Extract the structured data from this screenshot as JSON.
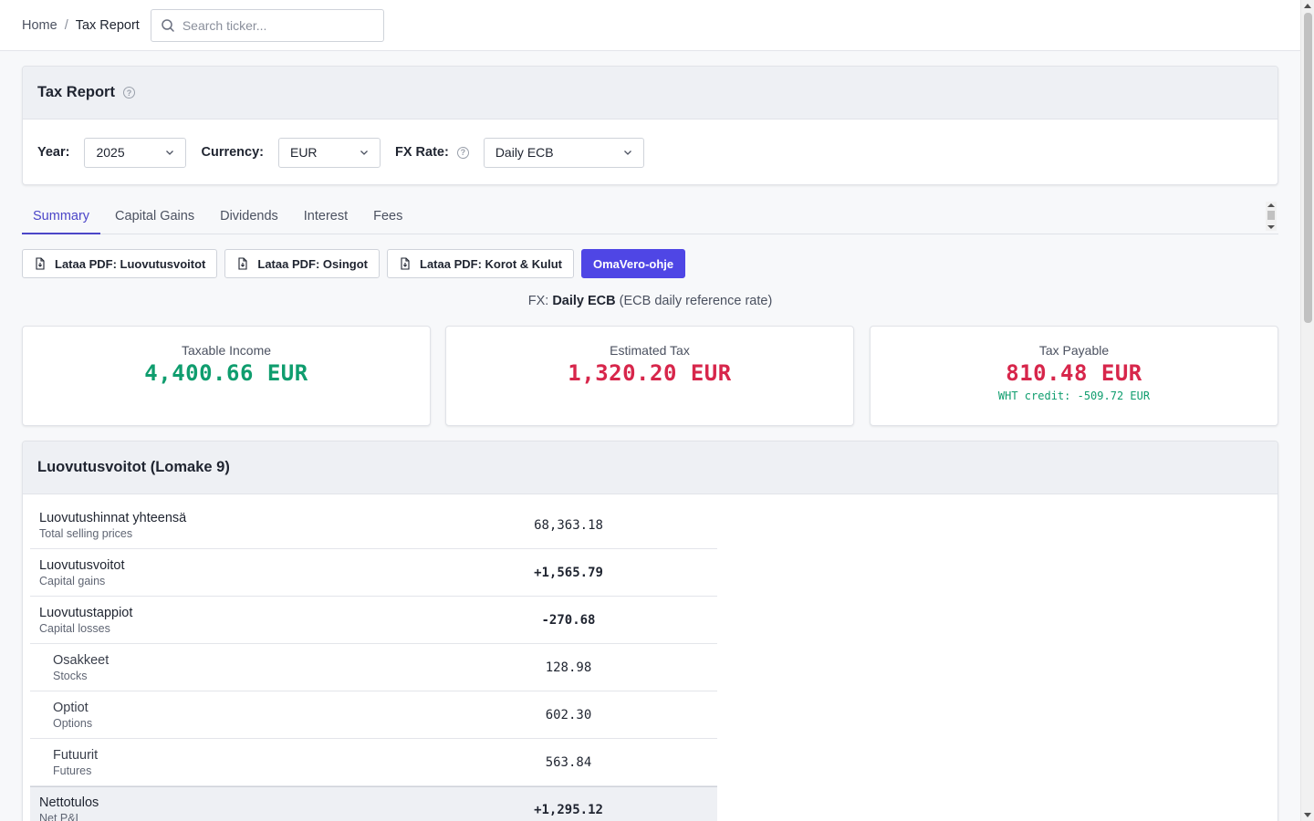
{
  "breadcrumb": {
    "home": "Home",
    "separator": "/",
    "current": "Tax Report"
  },
  "search": {
    "placeholder": "Search ticker..."
  },
  "report": {
    "title": "Tax Report",
    "help": "?",
    "filters": {
      "year_label": "Year:",
      "year_value": "2025",
      "currency_label": "Currency:",
      "currency_value": "EUR",
      "fx_label": "FX Rate:",
      "fx_value": "Daily ECB"
    }
  },
  "tabs": [
    "Summary",
    "Capital Gains",
    "Dividends",
    "Interest",
    "Fees"
  ],
  "buttons": {
    "pdf_gains": "Lataa PDF: Luovutusvoitot",
    "pdf_dividends": "Lataa PDF: Osingot",
    "pdf_interest": "Lataa PDF: Korot & Kulut",
    "omavero": "OmaVero-ohje"
  },
  "fx_note": {
    "prefix": "FX:",
    "method": "Daily ECB",
    "desc": "(ECB daily reference rate)"
  },
  "summary": {
    "taxable_income_label": "Taxable Income",
    "taxable_income_value": "4,400.66 EUR",
    "estimated_tax_label": "Estimated Tax",
    "estimated_tax_value": "1,320.20 EUR",
    "tax_payable_label": "Tax Payable",
    "tax_payable_value": "810.48 EUR",
    "wht_credit": "WHT credit: -509.72 EUR"
  },
  "colors": {
    "accent": "#4f46e5",
    "positive": "#0f9d6e",
    "negative": "#d7264b"
  },
  "luovutusvoitot": {
    "title": "Luovutusvoitot (Lomake 9)",
    "rows": [
      {
        "fi": "Luovutushinnat yhteensä",
        "en": "Total selling prices",
        "amount": "68,363.18"
      },
      {
        "fi": "Luovutusvoitot",
        "en": "Capital gains",
        "amount": "+1,565.79"
      },
      {
        "fi": "Luovutustappiot",
        "en": "Capital losses",
        "amount": "-270.68"
      },
      {
        "fi": "Osakkeet",
        "en": "Stocks",
        "amount": "128.98"
      },
      {
        "fi": "Optiot",
        "en": "Options",
        "amount": "602.30"
      },
      {
        "fi": "Futuurit",
        "en": "Futures",
        "amount": "563.84"
      },
      {
        "fi": "Nettotulos",
        "en": "Net P&L",
        "amount": "+1,295.12"
      }
    ]
  }
}
